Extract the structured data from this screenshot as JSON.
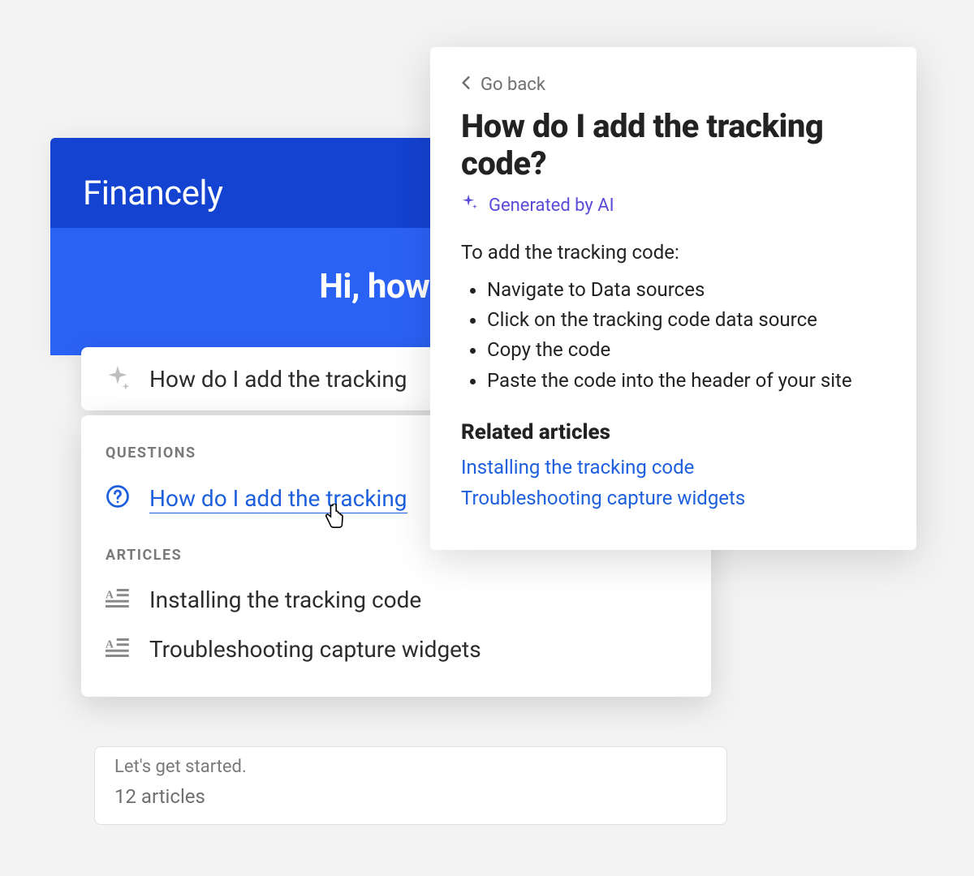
{
  "widget": {
    "brand": "Financely",
    "greeting": "Hi, how ca",
    "search_value": "How do I add the tracking",
    "sections": {
      "questions_label": "QUESTIONS",
      "articles_label": "ARTICLES"
    },
    "questions": [
      {
        "label": "How do I add the tracking"
      }
    ],
    "articles": [
      {
        "label": "Installing the tracking code"
      },
      {
        "label": "Troubleshooting capture widgets"
      }
    ],
    "peek": {
      "title": "Let's get started.",
      "count": "12 articles"
    }
  },
  "popover": {
    "go_back": "Go back",
    "title": "How do I add the tracking code?",
    "generated_by": "Generated by AI",
    "intro": "To add the tracking code:",
    "steps": [
      "Navigate to Data sources",
      "Click on the tracking code data source",
      "Copy the code",
      "Paste the code into the header of your site"
    ],
    "related_heading": "Related articles",
    "related": [
      "Installing the tracking code",
      "Troubleshooting capture widgets"
    ]
  },
  "colors": {
    "brand_dark_blue": "#1442d1",
    "brand_blue": "#2b62f6",
    "link_blue": "#1d5fdd",
    "ai_purple": "#5a4bdb"
  }
}
